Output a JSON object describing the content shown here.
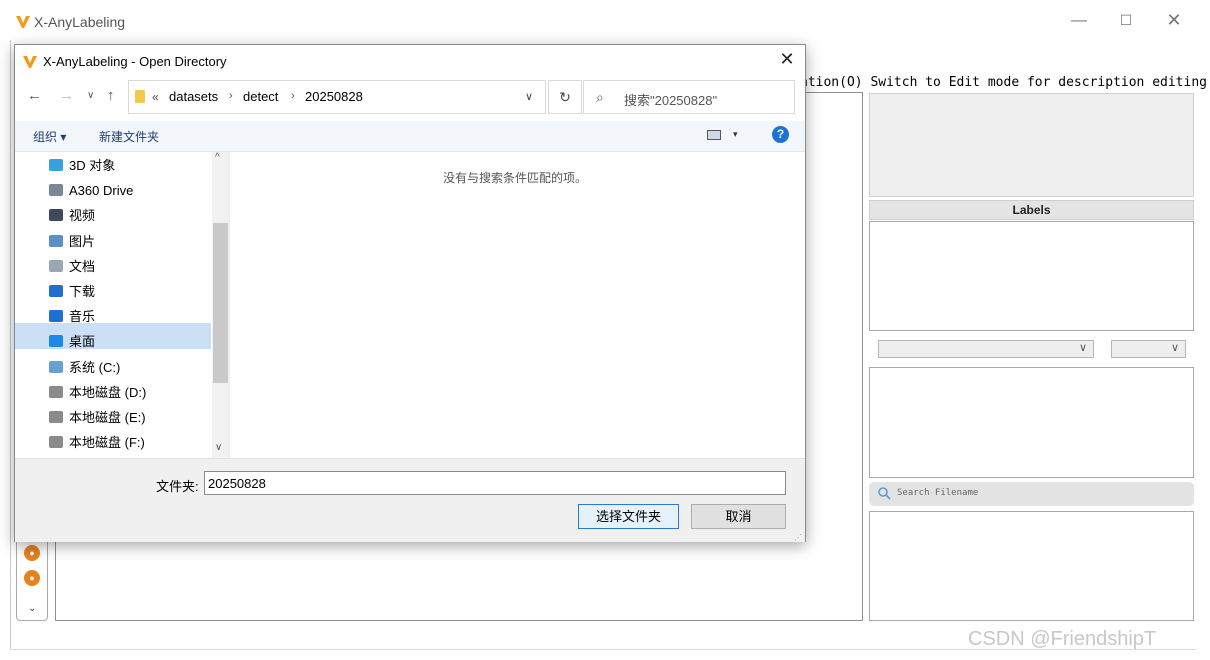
{
  "app": {
    "title": "X-AnyLabeling",
    "window_controls": {
      "minimize": "—",
      "maximize": "☐",
      "close": "✕"
    },
    "description_hint": "ation(O) Switch to Edit mode for description editing",
    "labels_header": "Labels",
    "search_placeholder": "Search Filename",
    "tool_more": "⌄",
    "watermark": "CSDN @FriendshipT"
  },
  "dialog": {
    "title": "X-AnyLabeling - Open Directory",
    "close": "✕",
    "nav": {
      "back": "←",
      "forward": "→",
      "recent": "∨",
      "up": "↑"
    },
    "address": {
      "overflow": "«",
      "crumbs": [
        "datasets",
        "detect",
        "20250828"
      ],
      "separator": "›",
      "dropdown": "∨"
    },
    "refresh": "↻",
    "search": {
      "placeholder": "搜索\"20250828\""
    },
    "commands": {
      "organize": "组织 ▾",
      "new_folder": "新建文件夹",
      "view_dropdown": "▾",
      "help": "?"
    },
    "nav_items": [
      {
        "label": "3D 对象",
        "icon": "cube-icon",
        "color": "#3aa0e0"
      },
      {
        "label": "A360 Drive",
        "icon": "cloud-drive-icon",
        "color": "#7a8794"
      },
      {
        "label": "视频",
        "icon": "video-icon",
        "color": "#3c4a5a"
      },
      {
        "label": "图片",
        "icon": "picture-icon",
        "color": "#5b8fc7"
      },
      {
        "label": "文档",
        "icon": "document-icon",
        "color": "#9aa6b2"
      },
      {
        "label": "下载",
        "icon": "download-icon",
        "color": "#1e6fd0"
      },
      {
        "label": "音乐",
        "icon": "music-icon",
        "color": "#1e6fd0"
      },
      {
        "label": "桌面",
        "icon": "desktop-icon",
        "color": "#1e88e5"
      },
      {
        "label": "系统 (C:)",
        "icon": "system-drive-icon",
        "color": "#6a9fd4"
      },
      {
        "label": "本地磁盘 (D:)",
        "icon": "drive-icon",
        "color": "#8a8a8a"
      },
      {
        "label": "本地磁盘 (E:)",
        "icon": "drive-icon",
        "color": "#8a8a8a"
      },
      {
        "label": "本地磁盘 (F:)",
        "icon": "drive-icon",
        "color": "#8a8a8a"
      }
    ],
    "selected_index": 11,
    "empty_message": "没有与搜索条件匹配的项。",
    "folder_label": "文件夹:",
    "folder_value": "20250828",
    "select_button": "选择文件夹",
    "cancel_button": "取消",
    "scroll": {
      "up": "^",
      "down": "∨"
    }
  },
  "colors": {
    "logo": "#f29a1d",
    "accent": "#1e73d2"
  }
}
